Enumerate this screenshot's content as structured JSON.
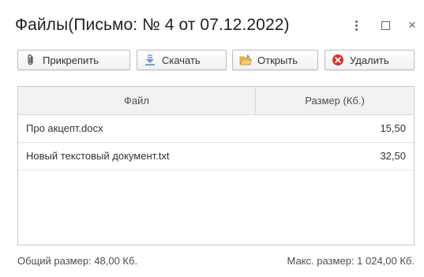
{
  "window": {
    "title": "Файлы(Письмо: № 4 от 07.12.2022)",
    "controls": [
      "more-icon",
      "maximize-icon",
      "close-icon"
    ],
    "close_glyph": "×"
  },
  "toolbar": {
    "attach_label": "Прикрепить",
    "download_label": "Скачать",
    "open_label": "Открыть",
    "delete_label": "Удалить",
    "icons": [
      "paperclip-icon",
      "download-arrow-icon",
      "open-folder-icon",
      "delete-icon"
    ]
  },
  "table": {
    "columns": [
      "Файл",
      "Размер (Кб.)"
    ],
    "rows": [
      {
        "name": "Про акцепт.docx",
        "size": "15,50"
      },
      {
        "name": "Новый текстовый документ.txt",
        "size": "32,50"
      }
    ]
  },
  "footer": {
    "total": "Общий размер: 48,00 Кб.",
    "max": "Макс. размер: 1 024,00 Кб."
  },
  "colors": {
    "delete_icon": "#d9342b",
    "folder_icon": "#e8b84a",
    "download_icon": "#6a8fcf"
  }
}
